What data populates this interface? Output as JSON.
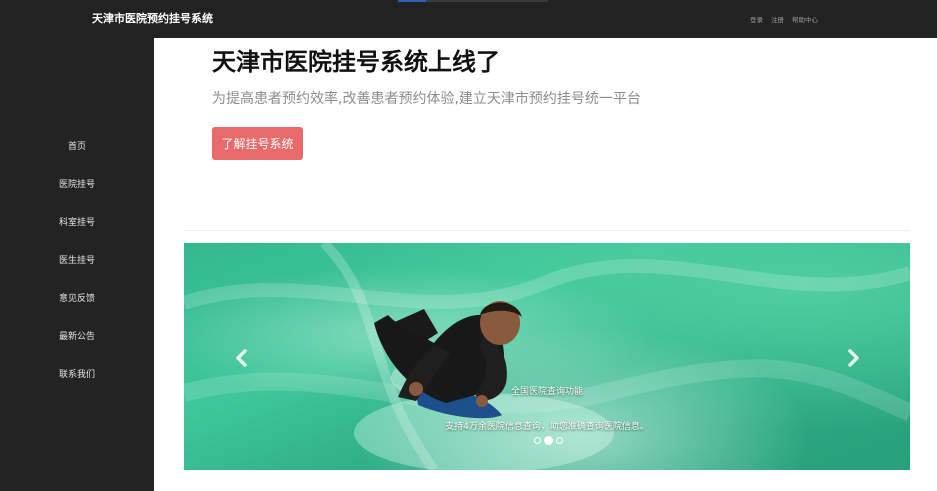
{
  "header": {
    "brand": "天津市医院预约挂号系统",
    "nav": [
      "登录",
      "注册",
      "帮助中心"
    ]
  },
  "sidebar": {
    "items": [
      {
        "label": "首页"
      },
      {
        "label": "医院挂号"
      },
      {
        "label": "科室挂号"
      },
      {
        "label": "医生挂号"
      },
      {
        "label": "意见反馈"
      },
      {
        "label": "最新公告"
      },
      {
        "label": "联系我们"
      }
    ]
  },
  "hero": {
    "title": "天津市医院挂号系统上线了",
    "subtitle": "为提高患者预约效率,改善患者预约体验,建立天津市预约挂号统一平台",
    "button": "了解挂号系统"
  },
  "carousel": {
    "caption_title": "全国医院查询功能",
    "caption_text": "支持4万余医院信息查询，助您准确查询医院信息。",
    "slide_count": 3,
    "active_index": 1,
    "prev_icon": "chevron-left-icon",
    "next_icon": "chevron-right-icon"
  },
  "colors": {
    "topbar": "#222222",
    "sidebar": "#232323",
    "button": "#e86a6a",
    "carousel_water": "#3ec79a"
  }
}
